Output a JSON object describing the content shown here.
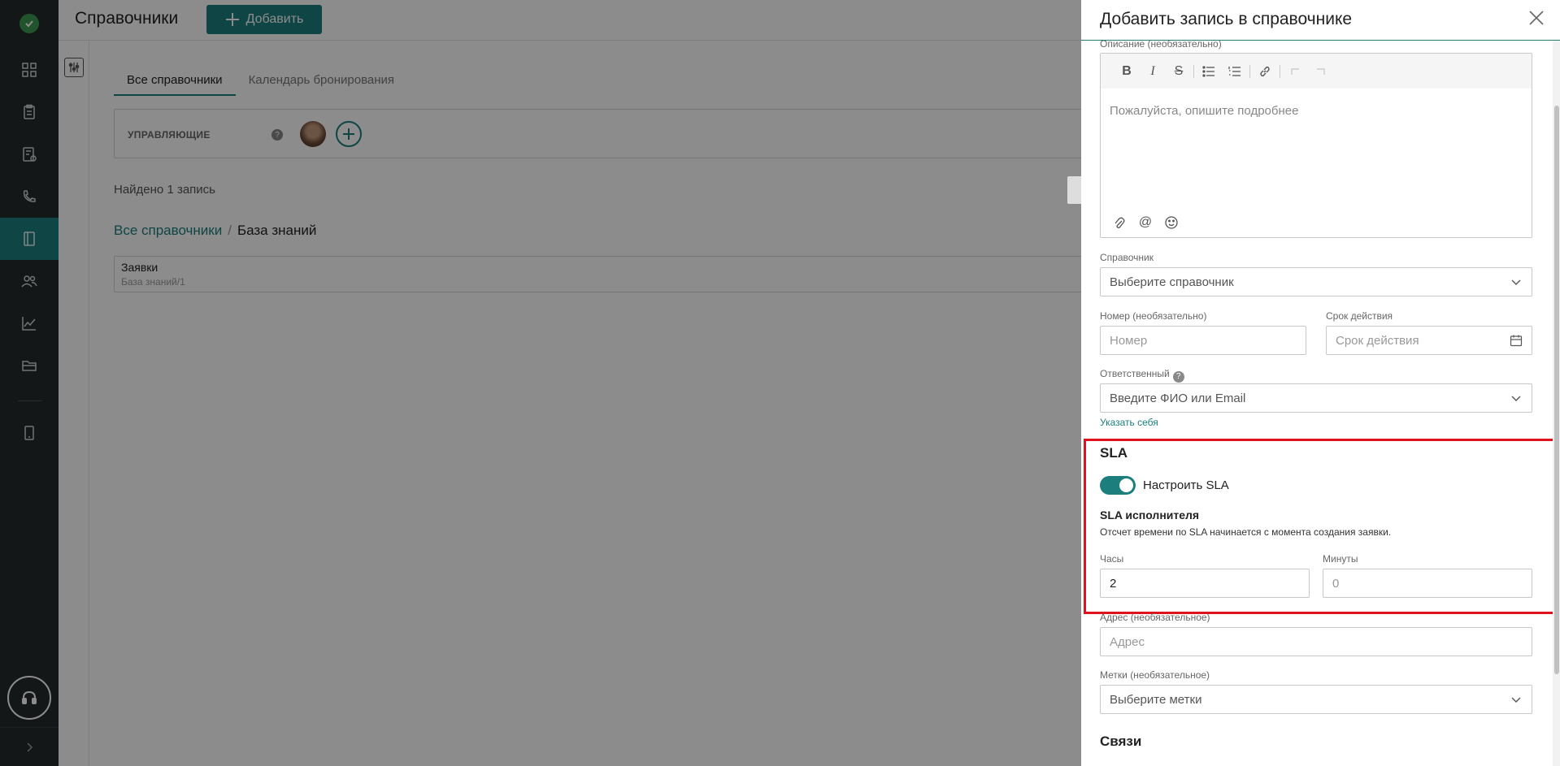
{
  "app": {
    "page_title": "Справочники",
    "add_button": "Добавить"
  },
  "sidebar": {
    "items": [
      {
        "icon": "dashboard-icon"
      },
      {
        "icon": "clipboard-icon"
      },
      {
        "icon": "document-settings-icon"
      },
      {
        "icon": "phone-icon"
      },
      {
        "icon": "book-icon",
        "active": true
      },
      {
        "icon": "users-icon"
      },
      {
        "icon": "chart-icon"
      },
      {
        "icon": "folder-icon"
      },
      {
        "icon": "tablet-icon"
      }
    ],
    "support_icon": "headset-icon",
    "expand_icon": "chevron-right-icon"
  },
  "main": {
    "tabs": [
      {
        "label": "Все справочники",
        "active": true
      },
      {
        "label": "Календарь бронирования",
        "active": false
      }
    ],
    "managers_label": "УПРАВЛЯЮЩИЕ",
    "help_mark": "?",
    "found_text": "Найдено 1 запись",
    "breadcrumb": {
      "root": "Все справочники",
      "separator": "/",
      "current": "База знаний"
    },
    "rows": [
      {
        "title": "Заявки",
        "subtitle": "База знаний/1"
      }
    ]
  },
  "drawer": {
    "title": "Добавить запись в справочнике",
    "description_label": "Описание (необязательно)",
    "description_placeholder": "Пожалуйста, опишите подробнее",
    "directory_label": "Справочник",
    "directory_placeholder": "Выберите справочник",
    "number_label": "Номер (необязательно)",
    "number_placeholder": "Номер",
    "validity_label": "Срок действия",
    "validity_placeholder": "Срок действия",
    "responsible_label": "Ответственный",
    "responsible_placeholder": "Введите ФИО или Email",
    "assign_self": "Указать себя",
    "sla": {
      "title": "SLA",
      "toggle_label": "Настроить SLA",
      "toggle_on": true,
      "subtitle": "SLA исполнителя",
      "note": "Отсчет времени по SLA начинается с момента создания заявки.",
      "hours_label": "Часы",
      "hours_value": "2",
      "minutes_label": "Минуты",
      "minutes_placeholder": "0"
    },
    "address_label": "Адрес (необязательное)",
    "address_placeholder": "Адрес",
    "tags_label": "Метки (необязательное)",
    "tags_placeholder": "Выберите метки",
    "links_heading": "Связи"
  },
  "colors": {
    "accent": "#1c7f7e",
    "rail": "#262a2c",
    "highlight": "#e0131d"
  }
}
